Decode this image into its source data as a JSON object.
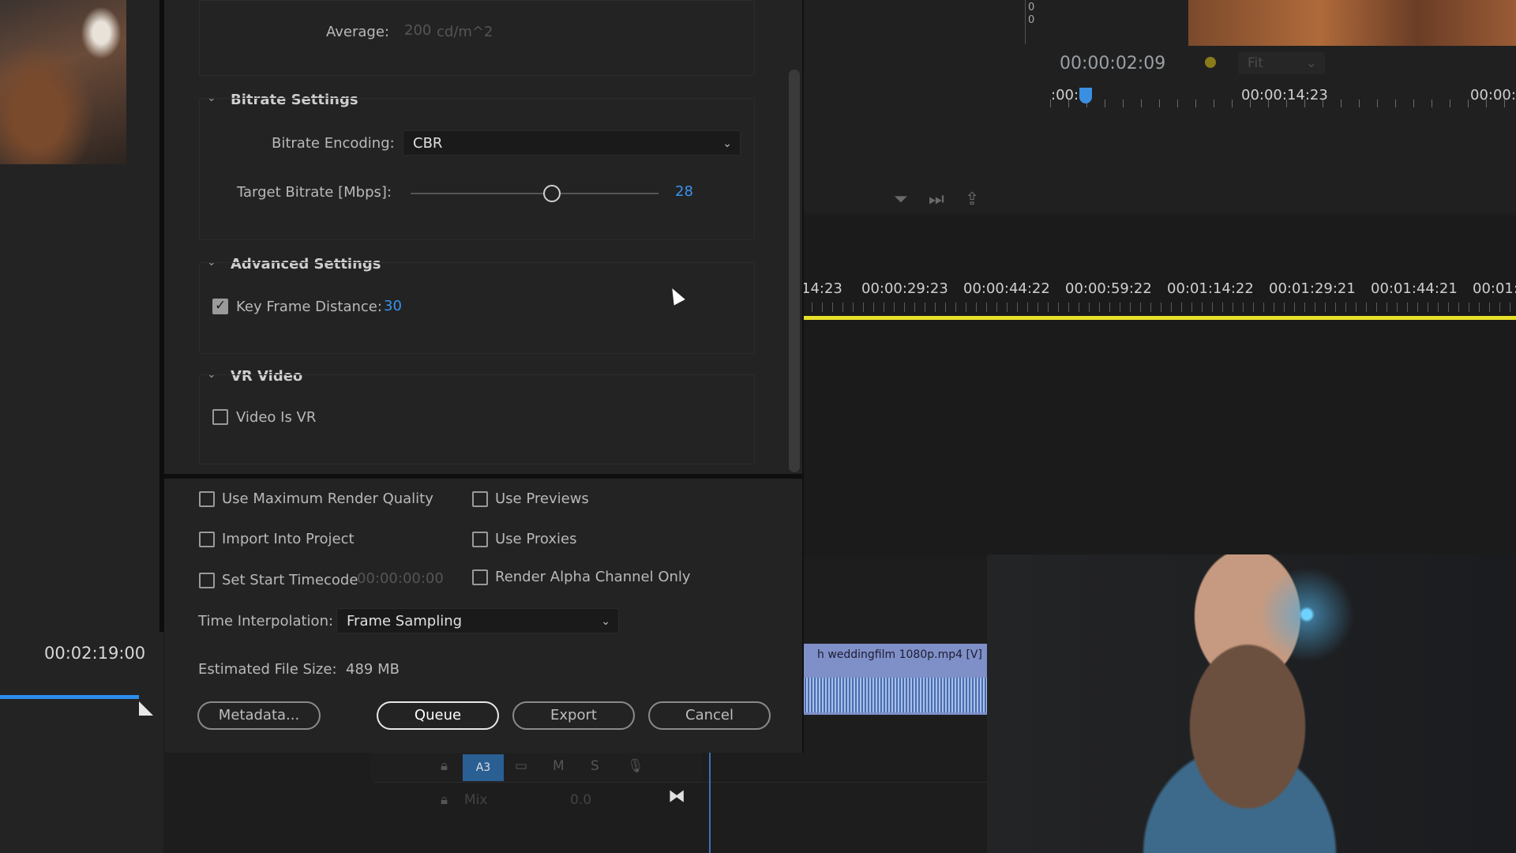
{
  "left_panel": {
    "timecode": "00:02:19:00"
  },
  "program_monitor": {
    "timecode": "00:00:02:09",
    "fit_select": "Fit",
    "meter_top": "0",
    "meter_bottom": "0",
    "scale_labels": [
      ":00:",
      "00:00:14:23",
      "00:00:"
    ]
  },
  "timeline": {
    "ruler_labels": [
      "14:23",
      "00:00:29:23",
      "00:00:44:22",
      "00:00:59:22",
      "00:01:14:22",
      "00:01:29:21",
      "00:01:44:21",
      "00:01:"
    ],
    "clip_label": "h  weddingfilm  1080p.mp4 [V]",
    "track_badge": "A3",
    "track_m": "M",
    "track_s": "S",
    "mix_label": "Mix",
    "mix_value": "0.0"
  },
  "export_dialog": {
    "average_label": "Average:",
    "average_value": "200",
    "average_unit": "cd/m^2",
    "bitrate_settings": {
      "title": "Bitrate Settings",
      "encoding_label": "Bitrate Encoding:",
      "encoding_value": "CBR",
      "target_label": "Target Bitrate [Mbps]:",
      "target_value": "28",
      "target_fraction": 0.57
    },
    "advanced_settings": {
      "title": "Advanced Settings",
      "keyframe_label": "Key Frame Distance:",
      "keyframe_value": "30",
      "keyframe_checked": true
    },
    "vr_video": {
      "title": "VR Video",
      "vr_label": "Video Is VR",
      "vr_checked": false
    },
    "options": {
      "max_render": "Use Maximum Render Quality",
      "use_previews": "Use Previews",
      "import_project": "Import Into Project",
      "use_proxies": "Use Proxies",
      "set_start_tc": "Set Start Timecode",
      "start_tc_value": "00:00:00:00",
      "render_alpha": "Render Alpha Channel Only"
    },
    "time_interp_label": "Time Interpolation:",
    "time_interp_value": "Frame Sampling",
    "file_size_label": "Estimated File Size:",
    "file_size_value": "489 MB",
    "buttons": {
      "metadata": "Metadata...",
      "queue": "Queue",
      "export": "Export",
      "cancel": "Cancel"
    }
  }
}
